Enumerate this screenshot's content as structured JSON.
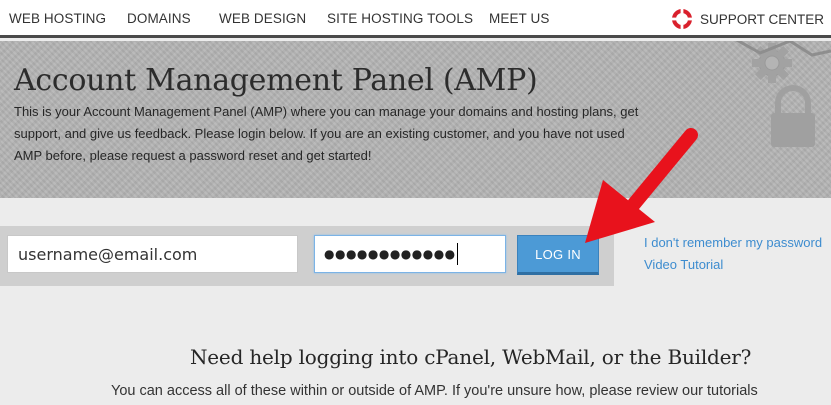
{
  "nav": {
    "items": [
      "WEB HOSTING",
      "DOMAINS",
      "WEB DESIGN",
      "SITE HOSTING TOOLS",
      "MEET US"
    ],
    "support_label": "SUPPORT CENTER",
    "support_icon": "life-ring-icon"
  },
  "hero": {
    "title": "Account Management Panel (AMP)",
    "description": "This is your Account Management Panel (AMP) where you can manage your domains and hosting plans, get support, and give us feedback. Please login below. If you are an existing customer, and you have not used AMP before, please request a password reset and get started!",
    "icons": [
      "gear-icon",
      "lock-icon"
    ]
  },
  "login": {
    "username_value": "username@email.com",
    "password_mask": "●●●●●●●●●●●●",
    "button_label": "LOG IN",
    "forgot_link": "I don't remember my password",
    "video_link": "Video Tutorial"
  },
  "help": {
    "title": "Need help logging into cPanel, WebMail, or the Builder?",
    "description": "You can access all of these within or outside of AMP. If you're unsure how, please review our tutorials"
  },
  "colors": {
    "accent_blue": "#4c9ad6",
    "link_blue": "#3d8ccf",
    "support_red": "#d9202c",
    "arrow_red": "#e8121c",
    "hero_gray": "#b4b4b4"
  }
}
